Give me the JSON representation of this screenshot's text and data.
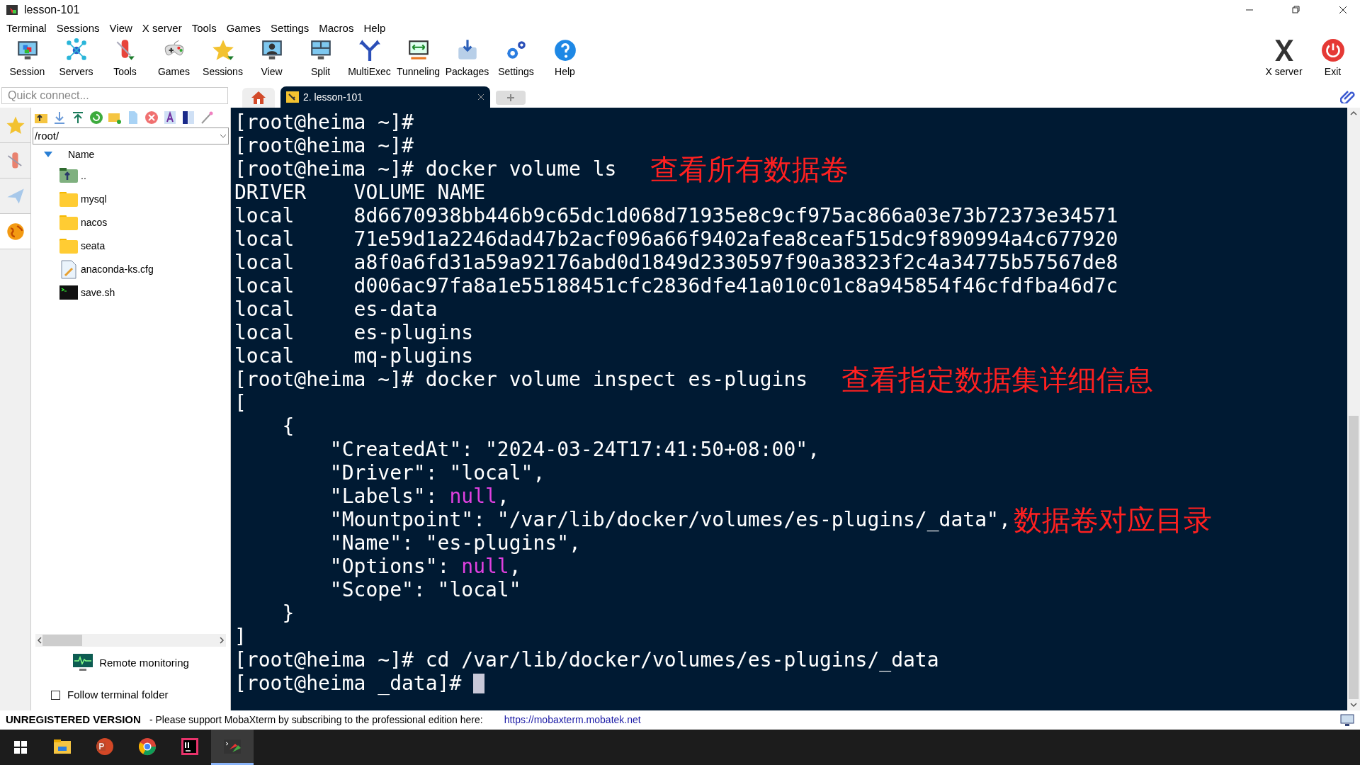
{
  "window": {
    "title": "lesson-101"
  },
  "menu": [
    "Terminal",
    "Sessions",
    "View",
    "X server",
    "Tools",
    "Games",
    "Settings",
    "Macros",
    "Help"
  ],
  "toolbar": [
    {
      "label": "Session"
    },
    {
      "label": "Servers"
    },
    {
      "label": "Tools"
    },
    {
      "label": "Games"
    },
    {
      "label": "Sessions"
    },
    {
      "label": "View"
    },
    {
      "label": "Split"
    },
    {
      "label": "MultiExec"
    },
    {
      "label": "Tunneling"
    },
    {
      "label": "Packages"
    },
    {
      "label": "Settings"
    },
    {
      "label": "Help"
    }
  ],
  "toolbar_right": [
    {
      "label": "X server"
    },
    {
      "label": "Exit"
    }
  ],
  "quick_connect": {
    "placeholder": "Quick connect..."
  },
  "tabs": [
    {
      "label": "2. lesson-101",
      "selected": true
    }
  ],
  "sidebar": {
    "path": "/root/",
    "column": "Name",
    "files": [
      {
        "name": "..",
        "kind": "parent"
      },
      {
        "name": "mysql",
        "kind": "folder"
      },
      {
        "name": "nacos",
        "kind": "folder"
      },
      {
        "name": "seata",
        "kind": "folder"
      },
      {
        "name": "anaconda-ks.cfg",
        "kind": "text"
      },
      {
        "name": "save.sh",
        "kind": "script"
      }
    ],
    "remote_monitoring": "Remote monitoring",
    "follow_folder": {
      "label": "Follow terminal folder",
      "checked": false
    }
  },
  "terminal": {
    "cursor": true,
    "lines": [
      {
        "segments": [
          {
            "text": "[root@heima ~]#",
            "kind": "plain"
          }
        ]
      },
      {
        "segments": [
          {
            "text": "[root@heima ~]#",
            "kind": "plain"
          }
        ]
      },
      {
        "segments": [
          {
            "text": "[root@heima ~]# docker volume ls",
            "kind": "plain"
          }
        ],
        "note": "查看所有数据卷"
      },
      {
        "segments": [
          {
            "text": "DRIVER    VOLUME NAME",
            "kind": "plain"
          }
        ]
      },
      {
        "segments": [
          {
            "text": "local     8d6670938bb446b9c65dc1d068d71935e8c9cf975ac866a03e73b72373e34571",
            "kind": "plain"
          }
        ]
      },
      {
        "segments": [
          {
            "text": "local     71e59d1a2246dad47b2acf096a66f9402afea8ceaf515dc9f890994a4c677920",
            "kind": "plain"
          }
        ]
      },
      {
        "segments": [
          {
            "text": "local     a8f0a6fd31a59a92176abd0d1849d2330597f90a38323f2c4a34775b57567de8",
            "kind": "plain"
          }
        ]
      },
      {
        "segments": [
          {
            "text": "local     d006ac97fa8a1e55188451cfc2836dfe41a010c01c8a945854f46cfdfba46d7c",
            "kind": "plain"
          }
        ]
      },
      {
        "segments": [
          {
            "text": "local     es-data",
            "kind": "plain"
          }
        ]
      },
      {
        "segments": [
          {
            "text": "local     es-plugins",
            "kind": "plain"
          }
        ]
      },
      {
        "segments": [
          {
            "text": "local     mq-plugins",
            "kind": "plain"
          }
        ]
      },
      {
        "segments": [
          {
            "text": "[root@heima ~]# docker volume inspect es-plugins",
            "kind": "plain"
          }
        ],
        "note": "查看指定数据集详细信息"
      },
      {
        "segments": [
          {
            "text": "[",
            "kind": "plain"
          }
        ]
      },
      {
        "segments": [
          {
            "text": "    {",
            "kind": "plain"
          }
        ]
      },
      {
        "segments": [
          {
            "text": "        \"CreatedAt\": \"2024-03-24T17:41:50+08:00\",",
            "kind": "plain"
          }
        ]
      },
      {
        "segments": [
          {
            "text": "        \"Driver\": \"local\",",
            "kind": "plain"
          }
        ]
      },
      {
        "segments": [
          {
            "text": "        \"Labels\": ",
            "kind": "plain"
          },
          {
            "text": "null",
            "kind": "keyword"
          },
          {
            "text": ",",
            "kind": "plain"
          }
        ]
      },
      {
        "segments": [
          {
            "text": "        \"Mountpoint\": \"/var/lib/docker/volumes/es-plugins/_data\",",
            "kind": "plain"
          }
        ],
        "note": "数据卷对应目录"
      },
      {
        "segments": [
          {
            "text": "        \"Name\": \"es-plugins\",",
            "kind": "plain"
          }
        ]
      },
      {
        "segments": [
          {
            "text": "        \"Options\": ",
            "kind": "plain"
          },
          {
            "text": "null",
            "kind": "keyword"
          },
          {
            "text": ",",
            "kind": "plain"
          }
        ]
      },
      {
        "segments": [
          {
            "text": "        \"Scope\": \"local\"",
            "kind": "plain"
          }
        ]
      },
      {
        "segments": [
          {
            "text": "    }",
            "kind": "plain"
          }
        ]
      },
      {
        "segments": [
          {
            "text": "]",
            "kind": "plain"
          }
        ]
      },
      {
        "segments": [
          {
            "text": "[root@heima ~]# cd /var/lib/docker/volumes/es-plugins/_data",
            "kind": "plain"
          }
        ]
      },
      {
        "segments": [
          {
            "text": "[root@heima _data]# ",
            "kind": "plain"
          }
        ]
      }
    ]
  },
  "status_bar": {
    "version": "UNREGISTERED VERSION",
    "message": "- Please support MobaXterm by subscribing to the professional edition here:",
    "link": "https://mobaxterm.mobatek.net"
  },
  "taskbar": {
    "apps": [
      {
        "selected": false
      },
      {
        "selected": false
      },
      {
        "selected": false
      },
      {
        "selected": false
      },
      {
        "selected": true
      }
    ]
  }
}
